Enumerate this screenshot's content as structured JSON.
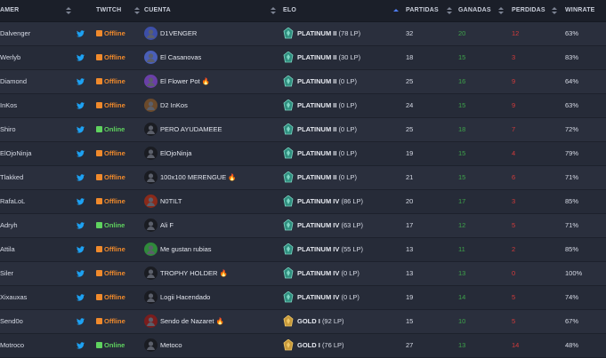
{
  "table": {
    "headers": {
      "player": "AMER",
      "twitch": "TWITCH",
      "account": "CUENTA",
      "elo": "ELO",
      "games": "PARTIDAS",
      "wins": "GANADAS",
      "losses": "PERDIDAS",
      "winrate": "WINRATE"
    },
    "rows": [
      {
        "player": "Dalvenger",
        "stream": "Offline",
        "account": "D1VENGER",
        "elo_rank": "PLATINUM II",
        "elo_lp": "(78 LP)",
        "games": "32",
        "wins": "20",
        "losses": "12",
        "winrate": "63%"
      },
      {
        "player": "Werlyb",
        "stream": "Offline",
        "account": "El Casanovas",
        "elo_rank": "PLATINUM II",
        "elo_lp": "(30 LP)",
        "games": "18",
        "wins": "15",
        "losses": "3",
        "winrate": "83%"
      },
      {
        "player": "Diamond",
        "stream": "Offline",
        "account": "El Flower Pot 🔥",
        "elo_rank": "PLATINUM II",
        "elo_lp": "(0 LP)",
        "games": "25",
        "wins": "16",
        "losses": "9",
        "winrate": "64%"
      },
      {
        "player": "InKos",
        "stream": "Offline",
        "account": "D2 InKos",
        "elo_rank": "PLATINUM II",
        "elo_lp": "(0 LP)",
        "games": "24",
        "wins": "15",
        "losses": "9",
        "winrate": "63%"
      },
      {
        "player": "Shiro",
        "stream": "Online",
        "account": "PERO AYUDAMEEE",
        "elo_rank": "PLATINUM II",
        "elo_lp": "(0 LP)",
        "games": "25",
        "wins": "18",
        "losses": "7",
        "winrate": "72%"
      },
      {
        "player": "ElOjoNinja",
        "stream": "Offline",
        "account": "ElOjoNinja",
        "elo_rank": "PLATINUM II",
        "elo_lp": "(0 LP)",
        "games": "19",
        "wins": "15",
        "losses": "4",
        "winrate": "79%"
      },
      {
        "player": "Tlakked",
        "stream": "Offline",
        "account": "100x100 MERENGUE 🔥",
        "elo_rank": "PLATINUM II",
        "elo_lp": "(0 LP)",
        "games": "21",
        "wins": "15",
        "losses": "6",
        "winrate": "71%"
      },
      {
        "player": "RafaLoL",
        "stream": "Offline",
        "account": "N0TILT",
        "elo_rank": "PLATINUM IV",
        "elo_lp": "(86 LP)",
        "games": "20",
        "wins": "17",
        "losses": "3",
        "winrate": "85%"
      },
      {
        "player": "Adryh",
        "stream": "Online",
        "account": "Ali F",
        "elo_rank": "PLATINUM IV",
        "elo_lp": "(63 LP)",
        "games": "17",
        "wins": "12",
        "losses": "5",
        "winrate": "71%"
      },
      {
        "player": "Attila",
        "stream": "Offline",
        "account": "Me gustan rubias",
        "elo_rank": "PLATINUM IV",
        "elo_lp": "(55 LP)",
        "games": "13",
        "wins": "11",
        "losses": "2",
        "winrate": "85%"
      },
      {
        "player": "Siler",
        "stream": "Offline",
        "account": "TROPHY HOLDER 🔥",
        "elo_rank": "PLATINUM IV",
        "elo_lp": "(0 LP)",
        "games": "13",
        "wins": "13",
        "losses": "0",
        "winrate": "100%"
      },
      {
        "player": "Xixauxas",
        "stream": "Offline",
        "account": "Logii Hacendado",
        "elo_rank": "PLATINUM IV",
        "elo_lp": "(0 LP)",
        "games": "19",
        "wins": "14",
        "losses": "5",
        "winrate": "74%"
      },
      {
        "player": "Send0o",
        "stream": "Offline",
        "account": "Sendo de Nazaret 🔥",
        "elo_rank": "GOLD I",
        "elo_lp": "(92 LP)",
        "games": "15",
        "wins": "10",
        "losses": "5",
        "winrate": "67%"
      },
      {
        "player": "Motroco",
        "stream": "Online",
        "account": "Metoco",
        "elo_rank": "GOLD I",
        "elo_lp": "(76 LP)",
        "games": "27",
        "wins": "13",
        "losses": "14",
        "winrate": "48%"
      }
    ]
  },
  "colors": {
    "offline": "#f08a2c",
    "online": "#5fd35f",
    "twitter": "#1da1f2",
    "wins": "#3ea34a",
    "losses": "#d33b3b",
    "sort_active": "#4f7df3"
  }
}
